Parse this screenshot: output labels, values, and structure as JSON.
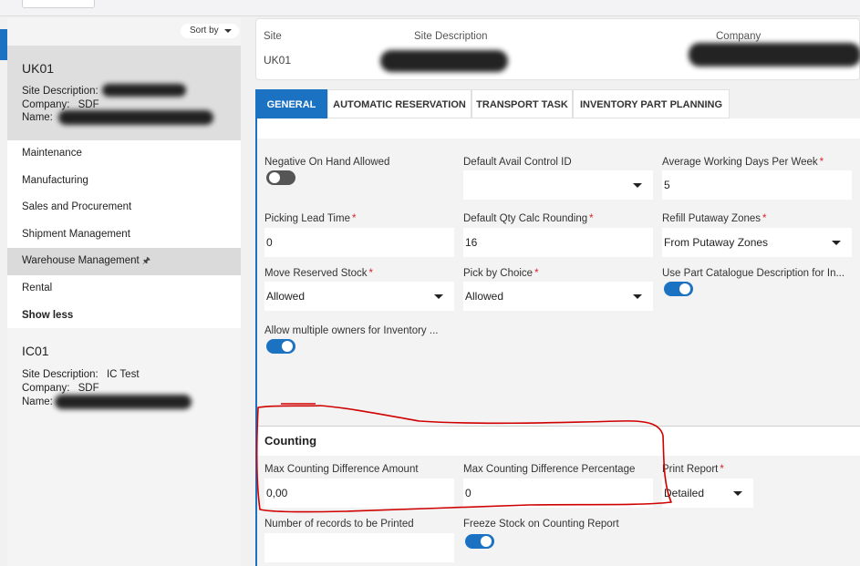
{
  "sort_label": "Sort by",
  "sites": [
    {
      "code": "UK01",
      "desc_label": "Site Description:",
      "desc_value": "",
      "company_label": "Company:",
      "company_value": "SDF",
      "name_label": "Name:",
      "name_value": ""
    },
    {
      "code": "IC01",
      "desc_label": "Site Description:",
      "desc_value": "IC Test",
      "company_label": "Company:",
      "company_value": "SDF",
      "name_label": "Name:",
      "name_value": ""
    }
  ],
  "menu": [
    "Maintenance",
    "Manufacturing",
    "Sales and Procurement",
    "Shipment Management",
    "Warehouse Management",
    "Rental",
    "Show less"
  ],
  "header": {
    "site_label": "Site",
    "site_value": "UK01",
    "desc_label": "Site Description",
    "company_label": "Company"
  },
  "tabs": [
    "GENERAL",
    "AUTOMATIC RESERVATION",
    "TRANSPORT TASK",
    "INVENTORY PART PLANNING"
  ],
  "fields": {
    "neg_on_hand": {
      "label": "Negative On Hand Allowed",
      "state": "off"
    },
    "default_avail": {
      "label": "Default Avail Control ID",
      "value": ""
    },
    "avg_days": {
      "label": "Average Working Days Per Week",
      "value": "5"
    },
    "picking_lead": {
      "label": "Picking Lead Time",
      "value": "0"
    },
    "qty_rounding": {
      "label": "Default Qty Calc Rounding",
      "value": "16"
    },
    "refill_zones": {
      "label": "Refill Putaway Zones",
      "value": "From Putaway Zones"
    },
    "move_reserved": {
      "label": "Move Reserved Stock",
      "value": "Allowed"
    },
    "pick_choice": {
      "label": "Pick by Choice",
      "value": "Allowed"
    },
    "part_catalogue": {
      "label": "Use Part Catalogue Description for In...",
      "state": "on"
    },
    "multi_owners": {
      "label": "Allow multiple owners for Inventory ...",
      "state": "on"
    }
  },
  "counting": {
    "title": "Counting",
    "max_amount": {
      "label": "Max Counting Difference Amount",
      "value": "0,00"
    },
    "max_pct": {
      "label": "Max Counting Difference Percentage",
      "value": "0"
    },
    "print_report": {
      "label": "Print Report",
      "value": "Detailed"
    },
    "num_records": {
      "label": "Number of records to be Printed",
      "value": ""
    },
    "freeze_stock": {
      "label": "Freeze Stock on Counting Report",
      "state": "on"
    }
  },
  "colors": {
    "accent": "#1b72c2",
    "required": "#d9242b",
    "annotation": "#d00000"
  }
}
